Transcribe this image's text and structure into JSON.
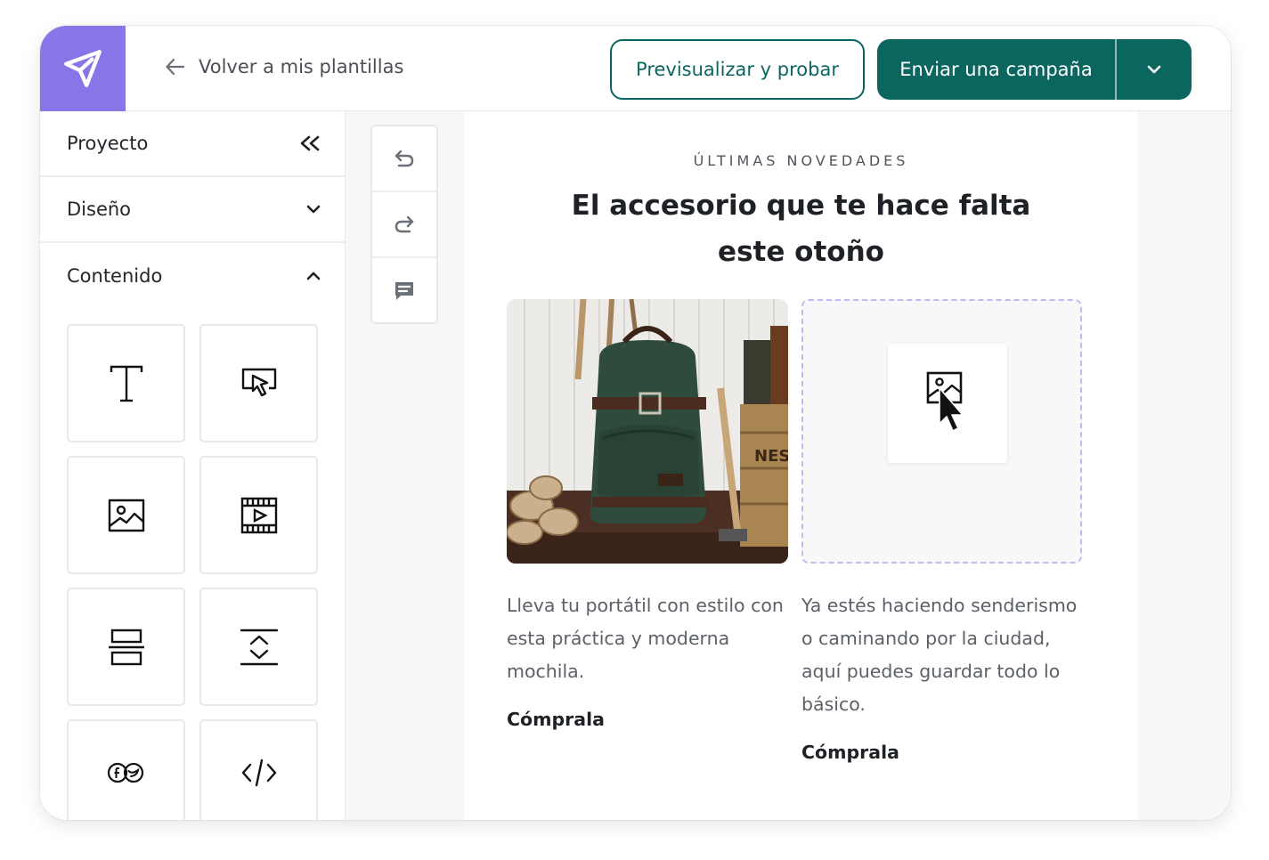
{
  "header": {
    "back_label": "Volver a mis plantillas",
    "preview_label": "Previsualizar y probar",
    "send_label": "Enviar una campaña"
  },
  "sidebar": {
    "sections": [
      {
        "label": "Proyecto",
        "icon": "collapse-double-chevron-icon"
      },
      {
        "label": "Diseño",
        "icon": "chevron-down-icon"
      },
      {
        "label": "Contenido",
        "icon": "chevron-up-icon"
      }
    ],
    "blocks": [
      "text-block-icon",
      "button-block-icon",
      "image-block-icon",
      "video-block-icon",
      "divider-block-icon",
      "spacer-block-icon",
      "social-block-icon",
      "html-block-icon"
    ]
  },
  "tools": [
    "undo-icon",
    "redo-icon",
    "comment-icon"
  ],
  "email": {
    "eyebrow": "ÚLTIMAS NOVEDADES",
    "headline": "El accesorio que te hace falta este otoño",
    "col1_text": "Lleva tu portátil con estilo con esta práctica y moderna mochila.",
    "col1_cta": "Cómprala",
    "col2_text": "Ya estés haciendo senderismo o caminando por la ciudad, aquí puedes guardar todo lo básico.",
    "col2_cta": "Cómprala",
    "crate_text": "NES"
  },
  "colors": {
    "brand_purple": "#8a75e8",
    "primary_teal": "#0b6660"
  }
}
